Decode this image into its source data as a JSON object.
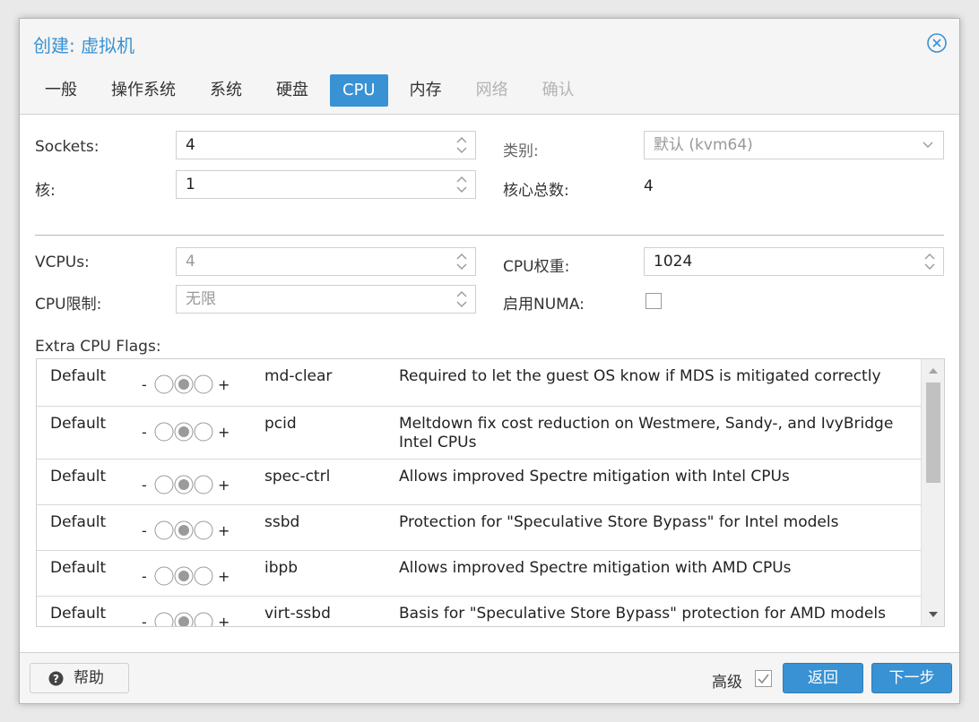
{
  "dialog": {
    "title": "创建: 虚拟机",
    "accent_color": "#3892d4",
    "close_icon": "close-circle-icon"
  },
  "tabs": [
    {
      "label": "一般",
      "state": "normal"
    },
    {
      "label": "操作系统",
      "state": "normal"
    },
    {
      "label": "系统",
      "state": "normal"
    },
    {
      "label": "硬盘",
      "state": "normal"
    },
    {
      "label": "CPU",
      "state": "active"
    },
    {
      "label": "内存",
      "state": "normal"
    },
    {
      "label": "网络",
      "state": "disabled"
    },
    {
      "label": "确认",
      "state": "disabled"
    }
  ],
  "cpu": {
    "sockets_label": "Sockets:",
    "sockets_value": "4",
    "cores_label": "核:",
    "cores_value": "1",
    "type_label": "类别:",
    "type_value": "默认 (kvm64)",
    "total_cores_label": "核心总数:",
    "total_cores_value": "4",
    "vcpus_label": "VCPUs:",
    "vcpus_value": "4",
    "cpu_limit_label": "CPU限制:",
    "cpu_limit_value": "无限",
    "cpu_units_label": "CPU权重:",
    "cpu_units_value": "1024",
    "numa_label": "启用NUMA:",
    "numa_checked": false
  },
  "flags": {
    "label": "Extra CPU Flags:",
    "rows": [
      {
        "state": "Default",
        "minus": "-",
        "plus": "+",
        "name": "md-clear",
        "desc": "Required to let the guest OS know if MDS is mitigated correctly"
      },
      {
        "state": "Default",
        "minus": "-",
        "plus": "+",
        "name": "pcid",
        "desc": "Meltdown fix cost reduction on Westmere, Sandy-, and IvyBridge Intel CPUs"
      },
      {
        "state": "Default",
        "minus": "-",
        "plus": "+",
        "name": "spec-ctrl",
        "desc": "Allows improved Spectre mitigation with Intel CPUs"
      },
      {
        "state": "Default",
        "minus": "-",
        "plus": "+",
        "name": "ssbd",
        "desc": "Protection for \"Speculative Store Bypass\" for Intel models"
      },
      {
        "state": "Default",
        "minus": "-",
        "plus": "+",
        "name": "ibpb",
        "desc": "Allows improved Spectre mitigation with AMD CPUs"
      },
      {
        "state": "Default",
        "minus": "-",
        "plus": "+",
        "name": "virt-ssbd",
        "desc": "Basis for \"Speculative Store Bypass\" protection for AMD models"
      }
    ]
  },
  "footer": {
    "help_label": "帮助",
    "advanced_label": "高级",
    "advanced_checked": true,
    "back_label": "返回",
    "next_label": "下一步"
  }
}
